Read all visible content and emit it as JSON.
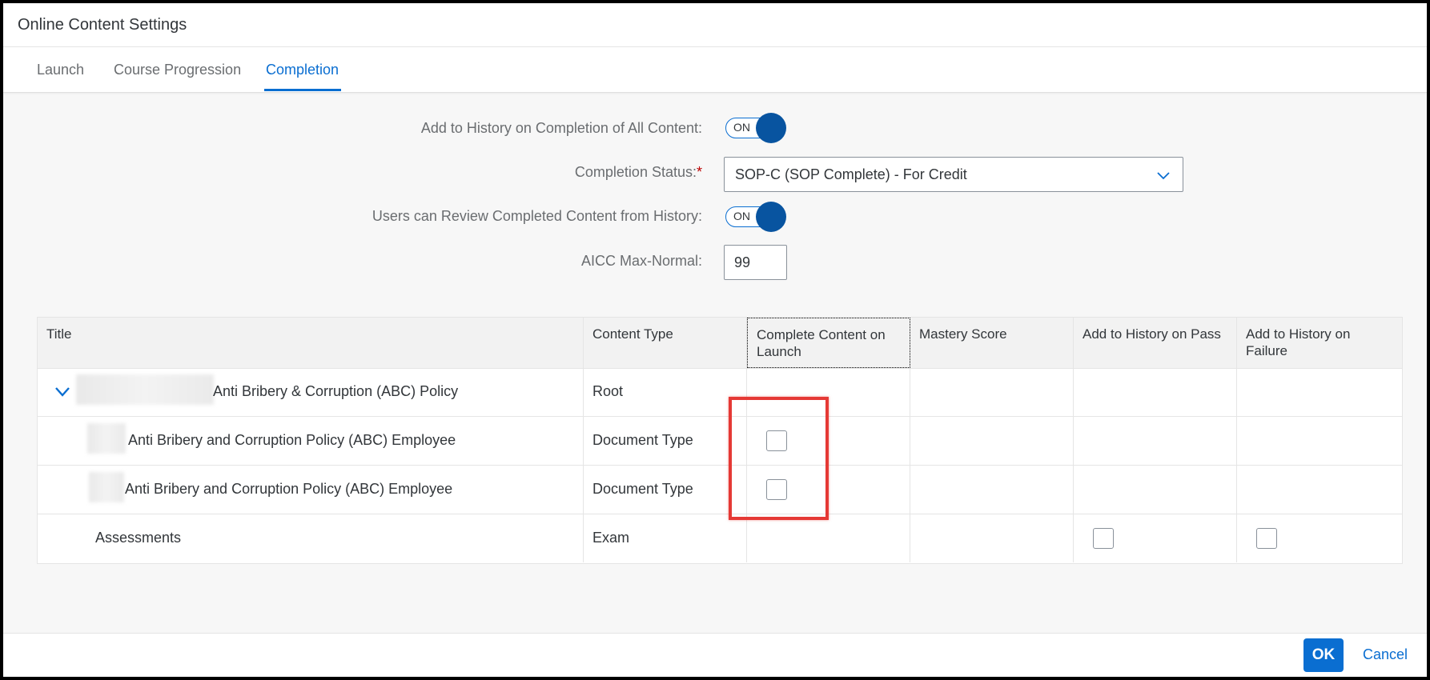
{
  "dialog": {
    "title": "Online Content Settings"
  },
  "tabs": [
    {
      "label": "Launch",
      "active": false
    },
    {
      "label": "Course Progression",
      "active": false
    },
    {
      "label": "Completion",
      "active": true
    }
  ],
  "form": {
    "add_history_label": "Add to History on Completion of All Content:",
    "add_history_toggle": "ON",
    "completion_status_label": "Completion Status:",
    "completion_status_required_mark": "*",
    "completion_status_value": "SOP-C (SOP Complete) - For Credit",
    "review_label": "Users can Review Completed Content from History:",
    "review_toggle": "ON",
    "aicc_label": "AICC Max-Normal:",
    "aicc_value": "99"
  },
  "table": {
    "columns": [
      "Title",
      "Content Type",
      "Complete Content on Launch",
      "Mastery Score",
      "Add to History on Pass",
      "Add to History on Failure"
    ],
    "rows": [
      {
        "title": "Anti Bribery & Corruption (ABC) Policy",
        "content_type": "Root"
      },
      {
        "title": "Anti Bribery and Corruption Policy (ABC) Employee",
        "content_type": "Document Type"
      },
      {
        "title": "Anti Bribery and Corruption Policy (ABC) Employee",
        "content_type": "Document Type"
      },
      {
        "title": "Assessments",
        "content_type": "Exam"
      }
    ]
  },
  "footer": {
    "ok_label": "OK",
    "cancel_label": "Cancel"
  },
  "colors": {
    "accent": "#0a6ed1",
    "toggle_knob": "#0854a0",
    "highlight": "#e53935",
    "required": "#bb0000"
  }
}
